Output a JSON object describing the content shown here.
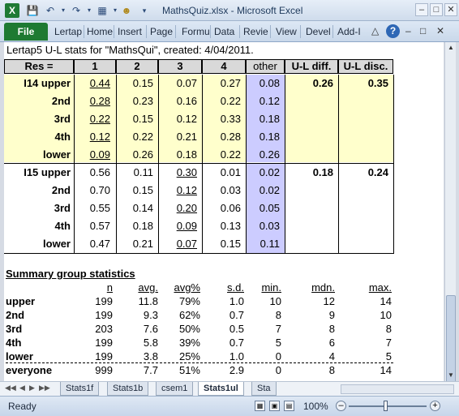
{
  "window": {
    "title": "MathsQuiz.xlsx - Microsoft Excel",
    "logo": "X"
  },
  "ribbon": {
    "file": "File",
    "tabs": [
      "Lertap",
      "Home",
      "Insert",
      "Page",
      "Formu",
      "Data",
      "Revie",
      "View",
      "Devel",
      "Add-I"
    ]
  },
  "sheet": {
    "title_line": "Lertap5 U-L stats for \"MathsQui\", created: 4/04/2011.",
    "headers": [
      "Res =",
      "1",
      "2",
      "3",
      "4",
      "other",
      "U-L diff.",
      "U-L disc."
    ],
    "items": [
      {
        "rows": [
          {
            "label": "I14 upper",
            "vals": [
              "0.44",
              "0.15",
              "0.07",
              "0.27",
              "0.08"
            ],
            "diff": "0.26",
            "disc": "0.35"
          },
          {
            "label": "2nd",
            "vals": [
              "0.28",
              "0.23",
              "0.16",
              "0.22",
              "0.12"
            ],
            "diff": "",
            "disc": ""
          },
          {
            "label": "3rd",
            "vals": [
              "0.22",
              "0.15",
              "0.12",
              "0.33",
              "0.18"
            ],
            "diff": "",
            "disc": ""
          },
          {
            "label": "4th",
            "vals": [
              "0.12",
              "0.22",
              "0.21",
              "0.28",
              "0.18"
            ],
            "diff": "",
            "disc": ""
          },
          {
            "label": "lower",
            "vals": [
              "0.09",
              "0.26",
              "0.18",
              "0.22",
              "0.26"
            ],
            "diff": "",
            "disc": ""
          }
        ]
      },
      {
        "rows": [
          {
            "label": "I15 upper",
            "vals": [
              "0.56",
              "0.11",
              "0.30",
              "0.01",
              "0.02"
            ],
            "diff": "0.18",
            "disc": "0.24"
          },
          {
            "label": "2nd",
            "vals": [
              "0.70",
              "0.15",
              "0.12",
              "0.03",
              "0.02"
            ],
            "diff": "",
            "disc": ""
          },
          {
            "label": "3rd",
            "vals": [
              "0.55",
              "0.14",
              "0.20",
              "0.06",
              "0.05"
            ],
            "diff": "",
            "disc": ""
          },
          {
            "label": "4th",
            "vals": [
              "0.57",
              "0.18",
              "0.09",
              "0.13",
              "0.03"
            ],
            "diff": "",
            "disc": ""
          },
          {
            "label": "lower",
            "vals": [
              "0.47",
              "0.21",
              "0.07",
              "0.15",
              "0.11"
            ],
            "diff": "",
            "disc": ""
          }
        ]
      }
    ],
    "summary": {
      "title": "Summary group statistics",
      "headers": [
        "n",
        "avg.",
        "avg%",
        "s.d.",
        "min.",
        "mdn.",
        "max."
      ],
      "rows": [
        {
          "label": "upper",
          "vals": [
            "199",
            "11.8",
            "79%",
            "1.0",
            "10",
            "12",
            "14"
          ]
        },
        {
          "label": "2nd",
          "vals": [
            "199",
            "9.3",
            "62%",
            "0.7",
            "8",
            "9",
            "10"
          ]
        },
        {
          "label": "3rd",
          "vals": [
            "203",
            "7.6",
            "50%",
            "0.5",
            "7",
            "8",
            "8"
          ]
        },
        {
          "label": "4th",
          "vals": [
            "199",
            "5.8",
            "39%",
            "0.7",
            "5",
            "6",
            "7"
          ]
        },
        {
          "label": "lower",
          "vals": [
            "199",
            "3.8",
            "25%",
            "1.0",
            "0",
            "4",
            "5"
          ]
        },
        {
          "label": "everyone",
          "vals": [
            "999",
            "7.7",
            "51%",
            "2.9",
            "0",
            "8",
            "14"
          ]
        }
      ]
    }
  },
  "sheet_tabs": [
    "Stats1f",
    "Stats1b",
    "csem1",
    "Stats1ul",
    "Sta"
  ],
  "active_tab": "Stats1ul",
  "status": {
    "ready": "Ready",
    "zoom": "100%"
  },
  "colors": {
    "yellow": "#ffffcc",
    "violet": "#ccccff",
    "excel_green": "#1e7a32"
  }
}
